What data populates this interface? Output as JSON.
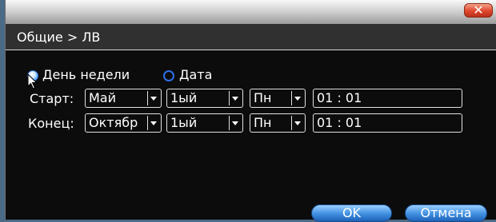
{
  "window": {
    "close_glyph": "✕",
    "breadcrumb": "Общие > ЛВ"
  },
  "mode": {
    "option1_label": "День недели",
    "option1_checked": true,
    "option2_label": "Дата",
    "option2_checked": false
  },
  "start": {
    "label": "Старт:",
    "month": "Май",
    "week": "1ый",
    "day": "Пн",
    "time": "01 : 01"
  },
  "end": {
    "label": "Конец:",
    "month": "Октябр",
    "week": "1ый",
    "day": "Пн",
    "time": "01 : 01"
  },
  "buttons": {
    "ok": "OK",
    "cancel": "Отмена"
  },
  "colors": {
    "dialog_bg": "#0c0c0c",
    "accent_blue": "#3f8ee0",
    "close_red": "#e0472c"
  }
}
